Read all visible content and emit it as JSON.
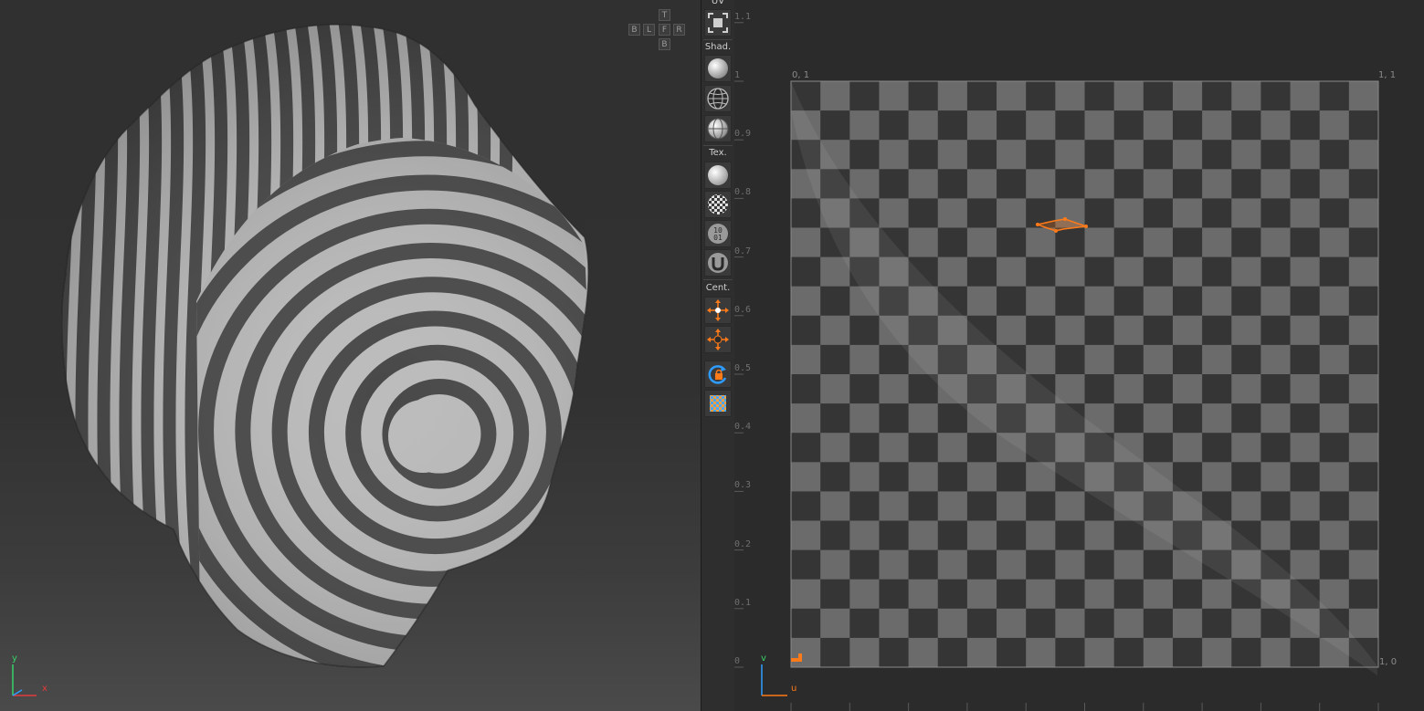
{
  "viewport3d": {
    "navcube": {
      "top": "T",
      "left_back": "B",
      "left": "L",
      "front": "F",
      "right": "R",
      "bottom": "B"
    },
    "axis": {
      "x": "x",
      "y": "y"
    },
    "colors": {
      "axis_x": "#e23a3a",
      "axis_y": "#38d16a",
      "stripe_light": "#b8b8b8",
      "stripe_dark": "#3e3e3e"
    }
  },
  "toolbar": {
    "uv_label": "UV",
    "shading_label": "Shad.",
    "texture_label": "Tex.",
    "center_label": "Cent.",
    "icons": [
      "uv-frame-icon",
      "shaded-sphere-icon",
      "wireframe-sphere-icon",
      "wire-shaded-sphere-icon",
      "plain-texture-icon",
      "checker-texture-icon",
      "numbered-texture-icon",
      "uv-texture-icon",
      "center-selection-icon",
      "center-all-icon",
      "lock-rotate-icon",
      "grid-texture-icon"
    ],
    "colors": {
      "accent": "#ff7a18",
      "lock": "#2e9cff"
    }
  },
  "uv_editor": {
    "v_ticks": [
      "1.1",
      "1",
      "0.9",
      "0.8",
      "0.7",
      "0.6",
      "0.5",
      "0.4",
      "0.3",
      "0.2",
      "0.1",
      "0"
    ],
    "corners": {
      "top_left": "0, 1",
      "top_right": "1, 1",
      "bottom_right": "1, 0"
    },
    "axis": {
      "u": "u",
      "v": "v"
    },
    "checker_cells": 20,
    "colors": {
      "checker_light": "#6b6b6b",
      "checker_dark": "#353535",
      "selection": "#ff7a18",
      "axis_u": "#ff7a18",
      "axis_v": "#2e9cff"
    }
  }
}
